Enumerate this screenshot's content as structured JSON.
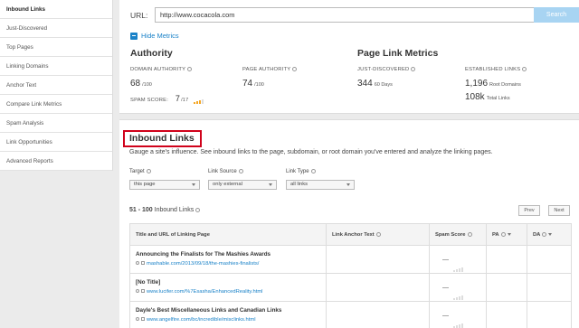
{
  "sidebar": {
    "items": [
      {
        "label": "Inbound Links",
        "active": true
      },
      {
        "label": "Just-Discovered"
      },
      {
        "label": "Top Pages"
      },
      {
        "label": "Linking Domains"
      },
      {
        "label": "Anchor Text"
      },
      {
        "label": "Compare Link Metrics"
      },
      {
        "label": "Spam Analysis"
      },
      {
        "label": "Link Opportunities"
      },
      {
        "label": "Advanced Reports"
      }
    ]
  },
  "search": {
    "url_label": "URL:",
    "url_value": "http://www.cocacola.com",
    "button_label": "Search"
  },
  "metrics": {
    "toggle_label": "Hide Metrics",
    "authority": {
      "title": "Authority",
      "domain_authority_label": "DOMAIN AUTHORITY",
      "domain_authority_value": "68",
      "domain_authority_unit": "/100",
      "page_authority_label": "PAGE AUTHORITY",
      "page_authority_value": "74",
      "page_authority_unit": "/100",
      "spam_score_label": "SPAM SCORE:",
      "spam_score_value": "7",
      "spam_score_unit": "/17"
    },
    "page_link": {
      "title": "Page Link Metrics",
      "just_discovered_label": "JUST-DISCOVERED",
      "just_discovered_value": "344",
      "just_discovered_unit": "60 Days",
      "established_label": "ESTABLISHED LINKS",
      "root_domains_value": "1,196",
      "root_domains_unit": "Root Domains",
      "total_links_value": "108k",
      "total_links_unit": "Total Links"
    }
  },
  "inbound": {
    "title": "Inbound Links",
    "description": "Gauge a site's influence. See inbound links to the page, subdomain, or root domain you've entered and analyze the linking pages.",
    "filters": {
      "target_label": "Target",
      "target_value": "this page",
      "link_source_label": "Link Source",
      "link_source_value": "only external",
      "link_type_label": "Link Type",
      "link_type_value": "all links"
    },
    "results_range": "51 - 100",
    "results_label": "Inbound Links",
    "prev_label": "Prev",
    "next_label": "Next",
    "table": {
      "headers": {
        "title_url": "Title and URL of Linking Page",
        "anchor": "Link Anchor Text",
        "spam": "Spam Score",
        "pa": "PA",
        "da": "DA"
      },
      "rows": [
        {
          "title": "Announcing the Finalists for The Mashies Awards",
          "url": "mashable.com/2013/09/18/the-mashies-finalists/",
          "spam": "—"
        },
        {
          "title": "[No Title]",
          "url": "www.lucifer.com/%7Esasha/EnhancedReality.html",
          "spam": "—"
        },
        {
          "title": "Dayle's Best Miscellaneous Links and Canadian Links",
          "url": "www.angelfire.com/bc/incredible/misclinks.html",
          "spam": "—"
        }
      ]
    }
  },
  "colors": {
    "accent": "#1a82c8",
    "highlight_border": "#d0021b",
    "search_button": "#a8d4f2",
    "spam_bar_active": "#f5a623"
  }
}
